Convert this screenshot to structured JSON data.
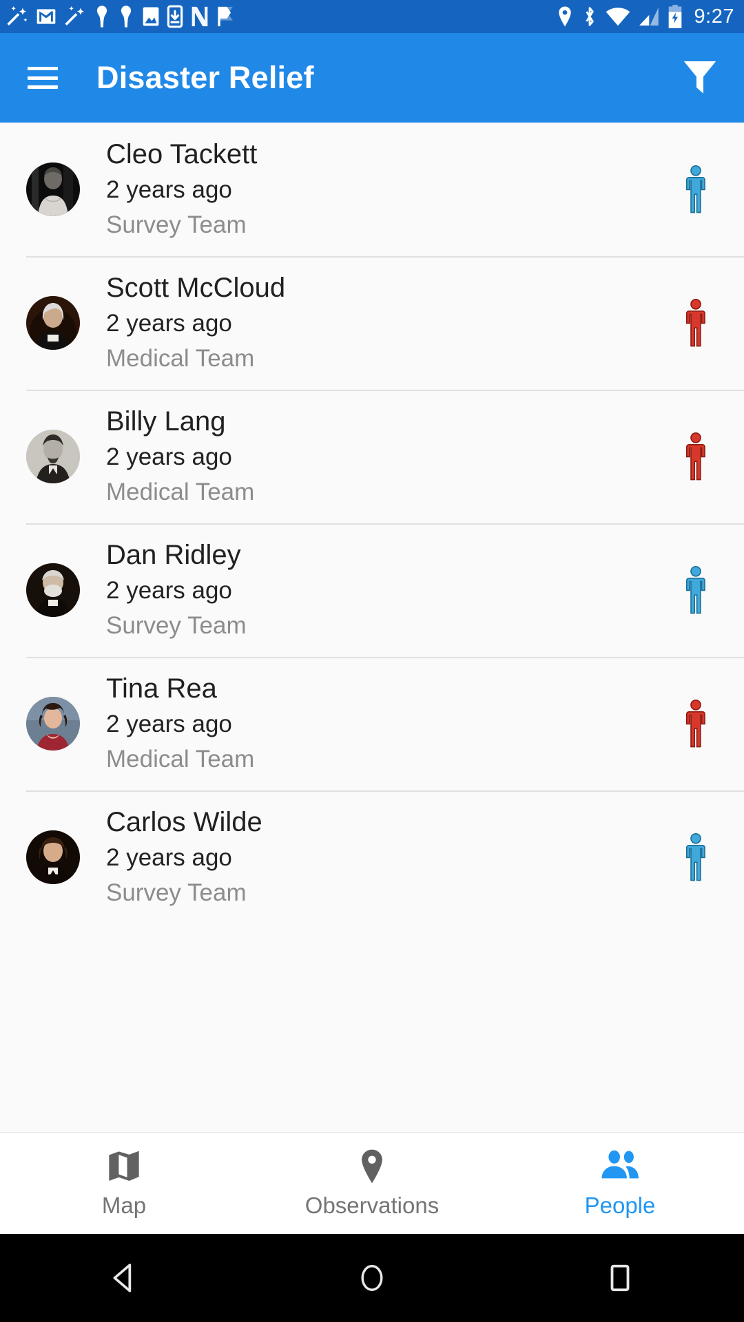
{
  "status_bar": {
    "time": "9:27",
    "background": "#1565C0",
    "left_icons": [
      "magic-wand-icon",
      "gmail-icon",
      "magic-wand-icon",
      "person-pin-icon",
      "person-pin-icon",
      "photo-icon",
      "download-phone-icon",
      "nova-n-icon",
      "check-flag-icon"
    ],
    "right_icons": [
      "location-pin-icon",
      "bluetooth-icon",
      "wifi-icon",
      "cellular-signal-icon",
      "battery-charging-icon"
    ]
  },
  "app_bar": {
    "title": "Disaster Relief",
    "menu_icon": "hamburger-menu-icon",
    "action_icon": "filter-funnel-icon",
    "background": "#2089E8"
  },
  "people": [
    {
      "name": "Cleo Tackett",
      "time": "2 years ago",
      "team": "Survey Team",
      "marker": "person-marker-blue",
      "marker_color": "#3FA9DC"
    },
    {
      "name": "Scott McCloud",
      "time": "2 years ago",
      "team": "Medical Team",
      "marker": "person-marker-red",
      "marker_color": "#D8382B"
    },
    {
      "name": "Billy Lang",
      "time": "2 years ago",
      "team": "Medical Team",
      "marker": "person-marker-red",
      "marker_color": "#D8382B"
    },
    {
      "name": "Dan Ridley",
      "time": "2 years ago",
      "team": "Survey Team",
      "marker": "person-marker-blue",
      "marker_color": "#3FA9DC"
    },
    {
      "name": "Tina Rea",
      "time": "2 years ago",
      "team": "Medical Team",
      "marker": "person-marker-red",
      "marker_color": "#D8382B"
    },
    {
      "name": "Carlos Wilde",
      "time": "2 years ago",
      "team": "Survey Team",
      "marker": "person-marker-blue",
      "marker_color": "#3FA9DC"
    }
  ],
  "bottom_nav": {
    "active_color": "#2196F3",
    "inactive_color": "#757575",
    "items": [
      {
        "label": "Map",
        "icon": "map-icon",
        "active": false
      },
      {
        "label": "Observations",
        "icon": "pin-icon",
        "active": false
      },
      {
        "label": "People",
        "icon": "people-icon",
        "active": true
      }
    ]
  },
  "system_nav": {
    "buttons": [
      "back-triangle-icon",
      "home-circle-icon",
      "recents-square-icon"
    ]
  }
}
